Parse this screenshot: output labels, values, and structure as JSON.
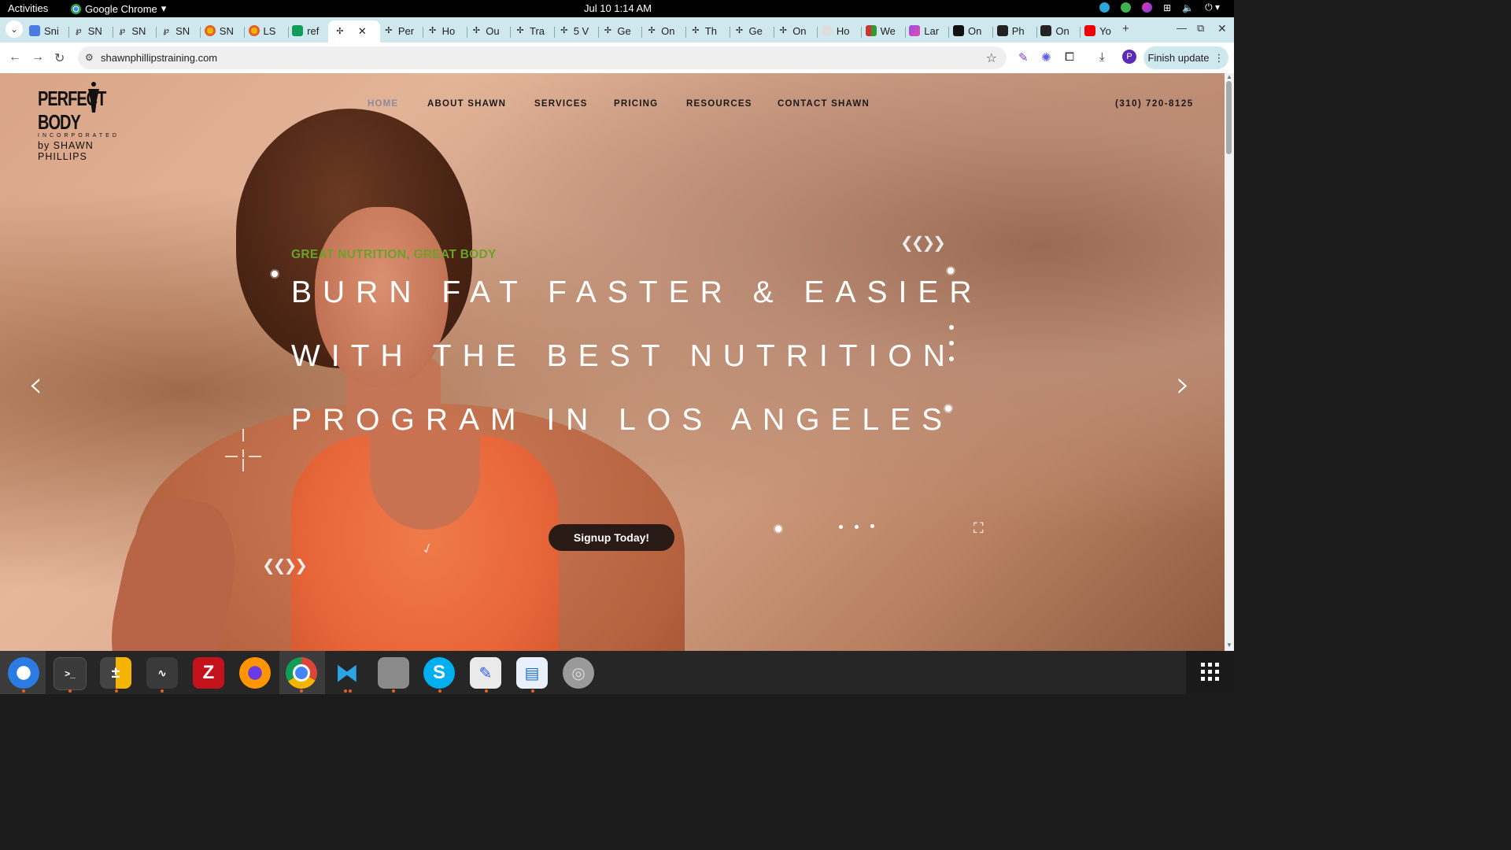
{
  "system_bar": {
    "activities": "Activities",
    "app_name": "Google Chrome",
    "clock": "Jul 10  1:14 AM"
  },
  "browser": {
    "tabs": [
      {
        "label": "Sni",
        "icon": "docs-icon"
      },
      {
        "label": "SN",
        "icon": "snp-icon"
      },
      {
        "label": "SN",
        "icon": "snp-icon"
      },
      {
        "label": "SN",
        "icon": "snp-icon"
      },
      {
        "label": "SN",
        "icon": "orange-icon"
      },
      {
        "label": "LS",
        "icon": "orange-icon"
      },
      {
        "label": "ref",
        "icon": "sheets-icon"
      },
      {
        "label": "",
        "icon": "perfectbody-icon",
        "active": true
      },
      {
        "label": "Per",
        "icon": "perfectbody-icon"
      },
      {
        "label": "Ho",
        "icon": "perfectbody-icon"
      },
      {
        "label": "Ou",
        "icon": "perfectbody-icon"
      },
      {
        "label": "Tra",
        "icon": "perfectbody-icon"
      },
      {
        "label": "5 V",
        "icon": "perfectbody-icon"
      },
      {
        "label": "Ge",
        "icon": "perfectbody-icon"
      },
      {
        "label": "On",
        "icon": "perfectbody-icon"
      },
      {
        "label": "Th",
        "icon": "perfectbody-icon"
      },
      {
        "label": "Ge",
        "icon": "perfectbody-icon"
      },
      {
        "label": "On",
        "icon": "perfectbody-icon"
      },
      {
        "label": "Ho",
        "icon": "globe-icon"
      },
      {
        "label": "We",
        "icon": "flag-icon"
      },
      {
        "label": "Lar",
        "icon": "lar-icon"
      },
      {
        "label": "On",
        "icon": "black-icon"
      },
      {
        "label": "Ph",
        "icon": "chart-icon"
      },
      {
        "label": "On",
        "icon": "chart-icon"
      },
      {
        "label": "Yo",
        "icon": "youtube-icon"
      }
    ],
    "new_tab": "+",
    "url": "shawnphillipstraining.com",
    "finish_update": "Finish update",
    "profile_initial": "P"
  },
  "site": {
    "logo": {
      "brand": "PERFECT BODY",
      "inc": "INCORPORATED",
      "by": "by SHAWN PHILLIPS"
    },
    "nav": {
      "home": "HOME",
      "about": "ABOUT SHAWN",
      "services": "SERVICES",
      "pricing": "PRICING",
      "resources": "RESOURCES",
      "contact": "CONTACT SHAWN"
    },
    "phone": "(310) 720-8125",
    "hero": {
      "eyebrow": "GREAT NUTRITION, GREAT BODY",
      "line1": "BURN FAT FASTER & EASIER",
      "line2": "WITH THE BEST NUTRITION",
      "line3": "PROGRAM IN LOS ANGELES",
      "cta": "Signup Today!"
    },
    "slider": {
      "prev": "‹",
      "next": "›",
      "chevrons": "❮❮❯❯"
    }
  },
  "colors": {
    "eyebrow": "#6aa326",
    "cta_bg": "#2a1a16",
    "tabstrip": "#cfe8ee"
  }
}
